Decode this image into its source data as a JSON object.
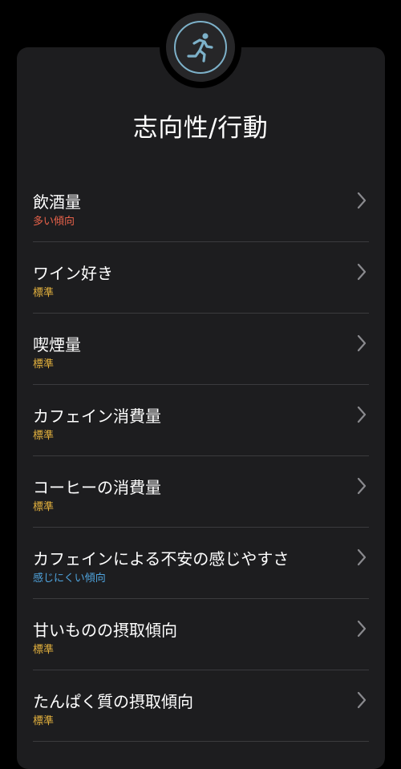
{
  "header": {
    "title": "志向性/行動",
    "badge_icon": "running-person-icon",
    "badge_icon_color": "#7db1c9"
  },
  "colors": {
    "background": "#000000",
    "card": "#1d1d1f",
    "divider": "#3b3b3e",
    "chevron": "#8a8a8e",
    "status_high": "#e8624a",
    "status_standard": "#e6b33e",
    "status_low": "#4fa3dd"
  },
  "traits": [
    {
      "label": "飲酒量",
      "status": "多い傾向",
      "status_color": "#e8624a",
      "icon": "chevron-right-icon"
    },
    {
      "label": "ワイン好き",
      "status": "標準",
      "status_color": "#e6b33e",
      "icon": "chevron-right-icon"
    },
    {
      "label": "喫煙量",
      "status": "標準",
      "status_color": "#e6b33e",
      "icon": "chevron-right-icon"
    },
    {
      "label": "カフェイン消費量",
      "status": "標準",
      "status_color": "#e6b33e",
      "icon": "chevron-right-icon"
    },
    {
      "label": "コーヒーの消費量",
      "status": "標準",
      "status_color": "#e6b33e",
      "icon": "chevron-right-icon"
    },
    {
      "label": "カフェインによる不安の感じやすさ",
      "status": "感じにくい傾向",
      "status_color": "#4fa3dd",
      "icon": "chevron-right-icon"
    },
    {
      "label": "甘いものの摂取傾向",
      "status": "標準",
      "status_color": "#e6b33e",
      "icon": "chevron-right-icon"
    },
    {
      "label": "たんぱく質の摂取傾向",
      "status": "標準",
      "status_color": "#e6b33e",
      "icon": "chevron-right-icon"
    }
  ]
}
